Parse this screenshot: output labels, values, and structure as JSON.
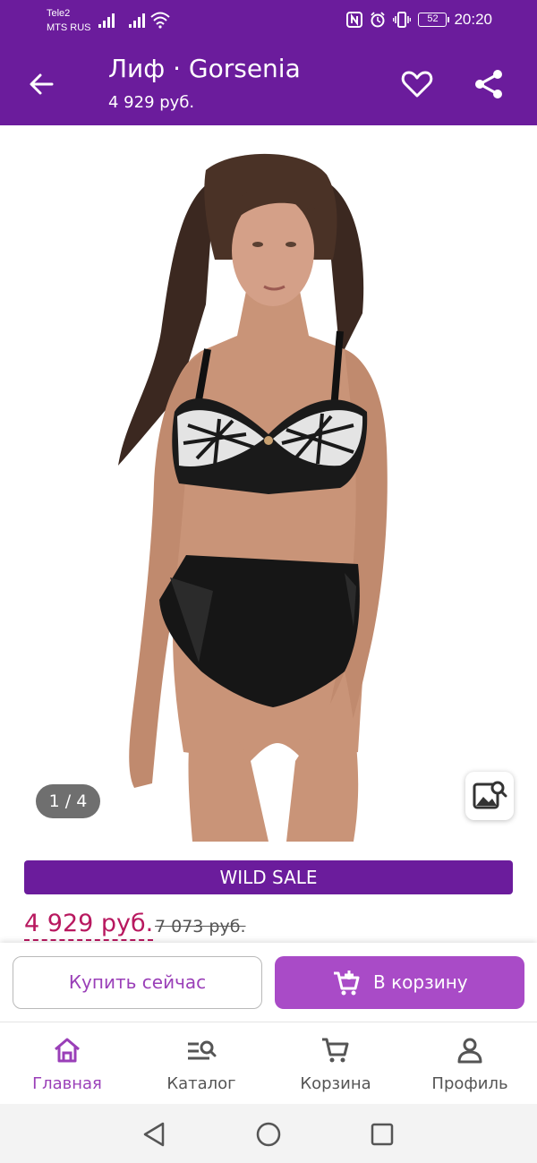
{
  "status_bar": {
    "carrier_1": "Tele2",
    "carrier_2": "MTS RUS",
    "battery": "52",
    "time": "20:20"
  },
  "app_bar": {
    "title": "Лиф · Gorsenia",
    "price": "4 929 руб."
  },
  "gallery": {
    "counter": "1 / 4"
  },
  "sale_banner": "WILD SALE",
  "price": {
    "current": "4 929 руб.",
    "old": "7 073 руб."
  },
  "actions": {
    "buy_now": "Купить сейчас",
    "add_to_cart": "В корзину"
  },
  "bottom_nav": {
    "items": [
      {
        "label": "Главная",
        "icon": "home-icon",
        "active": true
      },
      {
        "label": "Каталог",
        "icon": "catalog-search-icon",
        "active": false
      },
      {
        "label": "Корзина",
        "icon": "cart-icon",
        "active": false
      },
      {
        "label": "Профиль",
        "icon": "profile-icon",
        "active": false
      }
    ]
  },
  "colors": {
    "primary": "#6b1c9c",
    "accent": "#a94bc7",
    "price": "#b8185f"
  }
}
